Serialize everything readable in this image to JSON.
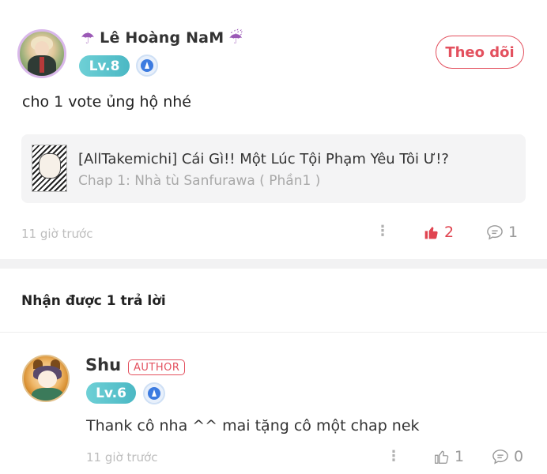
{
  "comment": {
    "username": "Lê Hoàng NaM",
    "username_prefix_icon": "umbrella-icon",
    "username_suffix_icon": "umbrella-rain-icon",
    "level": "Lv.8",
    "follow_label": "Theo dõi",
    "text": "cho 1 vote ủng hộ nhé",
    "chapter": {
      "title": "[AllTakemichi] Cái Gì!! Một Lúc Tội Phạm Yêu Tôi Ư!?",
      "subtitle": "Chap 1: Nhà tù Sanfurawa ( Phần1 )"
    },
    "time": "11 giờ trước",
    "likes": "2",
    "replies": "1"
  },
  "replies_header": "Nhận được 1 trả lời",
  "reply": {
    "username": "Shu",
    "author_tag": "AUTHOR",
    "level": "Lv.6",
    "text": "Thank cô nha ^^ mai tặng cô một chap nek",
    "time": "11 giờ trước",
    "likes": "1",
    "replies": "0"
  },
  "colors": {
    "accent": "#e3505e",
    "level_badge": "#4bb8c4",
    "like_active": "#e04450",
    "muted": "#9a9a9a"
  }
}
